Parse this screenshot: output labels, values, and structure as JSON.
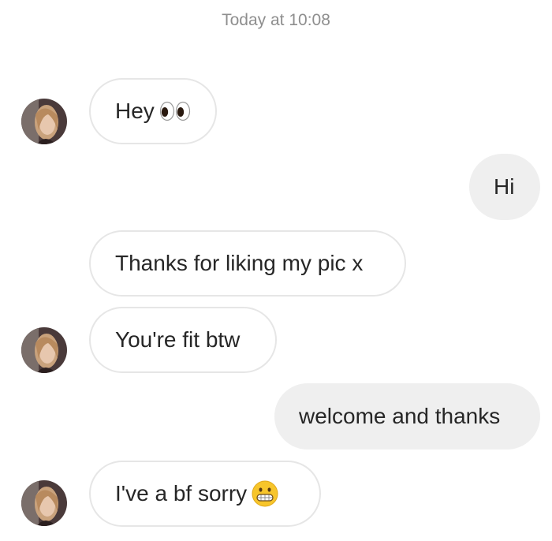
{
  "conversation": {
    "timestamp": "Today at 10:08",
    "messages": [
      {
        "direction": "incoming",
        "text": "Hey",
        "emoji": "eyes-emoji",
        "show_avatar": true
      },
      {
        "direction": "outgoing",
        "text": "Hi"
      },
      {
        "direction": "incoming",
        "text": "Thanks for liking my pic x",
        "show_avatar": false
      },
      {
        "direction": "incoming",
        "text": "You're fit btw",
        "show_avatar": true
      },
      {
        "direction": "outgoing",
        "text": "welcome and thanks"
      },
      {
        "direction": "incoming",
        "text": "I've a bf sorry",
        "emoji": "grimacing-face-emoji",
        "show_avatar": true
      }
    ]
  },
  "colors": {
    "incoming_bubble_bg": "#ffffff",
    "incoming_bubble_border": "#e6e6e6",
    "outgoing_bubble_bg": "#efefef",
    "timestamp_text": "#8e8e8e",
    "message_text": "#262626"
  }
}
